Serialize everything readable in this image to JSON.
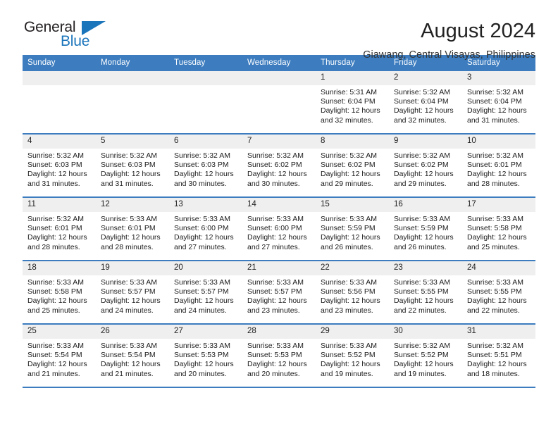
{
  "logo": {
    "word_top": "General",
    "word_bottom": "Blue",
    "triangle_color": "#1b75bb"
  },
  "header": {
    "title": "August 2024",
    "subtitle": "Giawang, Central Visayas, Philippines"
  },
  "theme": {
    "header_blue": "#3c7cbf",
    "daynum_grey": "#efefef",
    "text": "#1c1c1c"
  },
  "weekday_headers": [
    "Sunday",
    "Monday",
    "Tuesday",
    "Wednesday",
    "Thursday",
    "Friday",
    "Saturday"
  ],
  "weeks": [
    [
      {
        "day": "",
        "empty": true,
        "lines": []
      },
      {
        "day": "",
        "empty": true,
        "lines": []
      },
      {
        "day": "",
        "empty": true,
        "lines": []
      },
      {
        "day": "",
        "empty": true,
        "lines": []
      },
      {
        "day": "1",
        "empty": false,
        "lines": [
          "Sunrise: 5:31 AM",
          "Sunset: 6:04 PM",
          "Daylight: 12 hours",
          "and 32 minutes."
        ]
      },
      {
        "day": "2",
        "empty": false,
        "lines": [
          "Sunrise: 5:32 AM",
          "Sunset: 6:04 PM",
          "Daylight: 12 hours",
          "and 32 minutes."
        ]
      },
      {
        "day": "3",
        "empty": false,
        "lines": [
          "Sunrise: 5:32 AM",
          "Sunset: 6:04 PM",
          "Daylight: 12 hours",
          "and 31 minutes."
        ]
      }
    ],
    [
      {
        "day": "4",
        "empty": false,
        "lines": [
          "Sunrise: 5:32 AM",
          "Sunset: 6:03 PM",
          "Daylight: 12 hours",
          "and 31 minutes."
        ]
      },
      {
        "day": "5",
        "empty": false,
        "lines": [
          "Sunrise: 5:32 AM",
          "Sunset: 6:03 PM",
          "Daylight: 12 hours",
          "and 31 minutes."
        ]
      },
      {
        "day": "6",
        "empty": false,
        "lines": [
          "Sunrise: 5:32 AM",
          "Sunset: 6:03 PM",
          "Daylight: 12 hours",
          "and 30 minutes."
        ]
      },
      {
        "day": "7",
        "empty": false,
        "lines": [
          "Sunrise: 5:32 AM",
          "Sunset: 6:02 PM",
          "Daylight: 12 hours",
          "and 30 minutes."
        ]
      },
      {
        "day": "8",
        "empty": false,
        "lines": [
          "Sunrise: 5:32 AM",
          "Sunset: 6:02 PM",
          "Daylight: 12 hours",
          "and 29 minutes."
        ]
      },
      {
        "day": "9",
        "empty": false,
        "lines": [
          "Sunrise: 5:32 AM",
          "Sunset: 6:02 PM",
          "Daylight: 12 hours",
          "and 29 minutes."
        ]
      },
      {
        "day": "10",
        "empty": false,
        "lines": [
          "Sunrise: 5:32 AM",
          "Sunset: 6:01 PM",
          "Daylight: 12 hours",
          "and 28 minutes."
        ]
      }
    ],
    [
      {
        "day": "11",
        "empty": false,
        "lines": [
          "Sunrise: 5:32 AM",
          "Sunset: 6:01 PM",
          "Daylight: 12 hours",
          "and 28 minutes."
        ]
      },
      {
        "day": "12",
        "empty": false,
        "lines": [
          "Sunrise: 5:33 AM",
          "Sunset: 6:01 PM",
          "Daylight: 12 hours",
          "and 28 minutes."
        ]
      },
      {
        "day": "13",
        "empty": false,
        "lines": [
          "Sunrise: 5:33 AM",
          "Sunset: 6:00 PM",
          "Daylight: 12 hours",
          "and 27 minutes."
        ]
      },
      {
        "day": "14",
        "empty": false,
        "lines": [
          "Sunrise: 5:33 AM",
          "Sunset: 6:00 PM",
          "Daylight: 12 hours",
          "and 27 minutes."
        ]
      },
      {
        "day": "15",
        "empty": false,
        "lines": [
          "Sunrise: 5:33 AM",
          "Sunset: 5:59 PM",
          "Daylight: 12 hours",
          "and 26 minutes."
        ]
      },
      {
        "day": "16",
        "empty": false,
        "lines": [
          "Sunrise: 5:33 AM",
          "Sunset: 5:59 PM",
          "Daylight: 12 hours",
          "and 26 minutes."
        ]
      },
      {
        "day": "17",
        "empty": false,
        "lines": [
          "Sunrise: 5:33 AM",
          "Sunset: 5:58 PM",
          "Daylight: 12 hours",
          "and 25 minutes."
        ]
      }
    ],
    [
      {
        "day": "18",
        "empty": false,
        "lines": [
          "Sunrise: 5:33 AM",
          "Sunset: 5:58 PM",
          "Daylight: 12 hours",
          "and 25 minutes."
        ]
      },
      {
        "day": "19",
        "empty": false,
        "lines": [
          "Sunrise: 5:33 AM",
          "Sunset: 5:57 PM",
          "Daylight: 12 hours",
          "and 24 minutes."
        ]
      },
      {
        "day": "20",
        "empty": false,
        "lines": [
          "Sunrise: 5:33 AM",
          "Sunset: 5:57 PM",
          "Daylight: 12 hours",
          "and 24 minutes."
        ]
      },
      {
        "day": "21",
        "empty": false,
        "lines": [
          "Sunrise: 5:33 AM",
          "Sunset: 5:57 PM",
          "Daylight: 12 hours",
          "and 23 minutes."
        ]
      },
      {
        "day": "22",
        "empty": false,
        "lines": [
          "Sunrise: 5:33 AM",
          "Sunset: 5:56 PM",
          "Daylight: 12 hours",
          "and 23 minutes."
        ]
      },
      {
        "day": "23",
        "empty": false,
        "lines": [
          "Sunrise: 5:33 AM",
          "Sunset: 5:55 PM",
          "Daylight: 12 hours",
          "and 22 minutes."
        ]
      },
      {
        "day": "24",
        "empty": false,
        "lines": [
          "Sunrise: 5:33 AM",
          "Sunset: 5:55 PM",
          "Daylight: 12 hours",
          "and 22 minutes."
        ]
      }
    ],
    [
      {
        "day": "25",
        "empty": false,
        "lines": [
          "Sunrise: 5:33 AM",
          "Sunset: 5:54 PM",
          "Daylight: 12 hours",
          "and 21 minutes."
        ]
      },
      {
        "day": "26",
        "empty": false,
        "lines": [
          "Sunrise: 5:33 AM",
          "Sunset: 5:54 PM",
          "Daylight: 12 hours",
          "and 21 minutes."
        ]
      },
      {
        "day": "27",
        "empty": false,
        "lines": [
          "Sunrise: 5:33 AM",
          "Sunset: 5:53 PM",
          "Daylight: 12 hours",
          "and 20 minutes."
        ]
      },
      {
        "day": "28",
        "empty": false,
        "lines": [
          "Sunrise: 5:33 AM",
          "Sunset: 5:53 PM",
          "Daylight: 12 hours",
          "and 20 minutes."
        ]
      },
      {
        "day": "29",
        "empty": false,
        "lines": [
          "Sunrise: 5:33 AM",
          "Sunset: 5:52 PM",
          "Daylight: 12 hours",
          "and 19 minutes."
        ]
      },
      {
        "day": "30",
        "empty": false,
        "lines": [
          "Sunrise: 5:32 AM",
          "Sunset: 5:52 PM",
          "Daylight: 12 hours",
          "and 19 minutes."
        ]
      },
      {
        "day": "31",
        "empty": false,
        "lines": [
          "Sunrise: 5:32 AM",
          "Sunset: 5:51 PM",
          "Daylight: 12 hours",
          "and 18 minutes."
        ]
      }
    ]
  ]
}
